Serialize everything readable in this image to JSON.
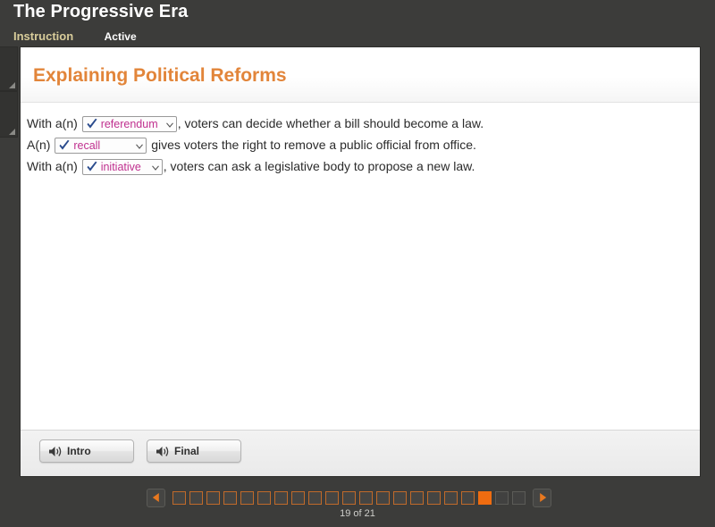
{
  "header": {
    "title": "The Progressive Era",
    "tabs": [
      {
        "label": "Instruction",
        "color": "#d8cc9a"
      },
      {
        "label": "Active",
        "color": "#ffffff"
      }
    ]
  },
  "lesson": {
    "title": "Explaining Political Reforms",
    "title_color": "#e2853a",
    "statements": [
      {
        "prefix": "With a(n) ",
        "answer": "referendum",
        "suffix": ", voters can decide whether a bill should become a law.",
        "icon": "check-icon",
        "width_class": "w-referendum"
      },
      {
        "prefix": "A(n) ",
        "answer": "recall",
        "suffix": " gives voters the right to remove a public official from office.",
        "icon": "check-icon",
        "width_class": "w-recall"
      },
      {
        "prefix": "With a(n) ",
        "answer": "initiative",
        "suffix": ", voters can ask a legislative body to propose a new law.",
        "icon": "check-icon",
        "width_class": "w-initiative"
      }
    ],
    "answer_text_color": "#c0308f",
    "check_color": "#2a4b8d"
  },
  "audio_buttons": [
    {
      "label": "Intro",
      "icon": "speaker-icon"
    },
    {
      "label": "Final",
      "icon": "speaker-icon"
    }
  ],
  "pager": {
    "prev_label": "Previous",
    "next_label": "Next",
    "prev_icon": "triangle-left-icon",
    "next_icon": "triangle-right-icon",
    "current_page": 19,
    "total_pages": 21,
    "count_text": "19 of 21",
    "accent_color": "#ef6c10",
    "pips": [
      {
        "state": "visited"
      },
      {
        "state": "visited"
      },
      {
        "state": "visited"
      },
      {
        "state": "visited"
      },
      {
        "state": "visited"
      },
      {
        "state": "visited"
      },
      {
        "state": "visited"
      },
      {
        "state": "visited"
      },
      {
        "state": "visited"
      },
      {
        "state": "visited"
      },
      {
        "state": "visited"
      },
      {
        "state": "visited"
      },
      {
        "state": "visited"
      },
      {
        "state": "visited"
      },
      {
        "state": "visited"
      },
      {
        "state": "visited"
      },
      {
        "state": "visited"
      },
      {
        "state": "visited"
      },
      {
        "state": "current"
      },
      {
        "state": "locked"
      },
      {
        "state": "locked"
      }
    ]
  },
  "rail": {
    "panels": [
      {
        "grip": "resize-grip-icon"
      },
      {
        "grip": "resize-grip-icon"
      }
    ]
  }
}
